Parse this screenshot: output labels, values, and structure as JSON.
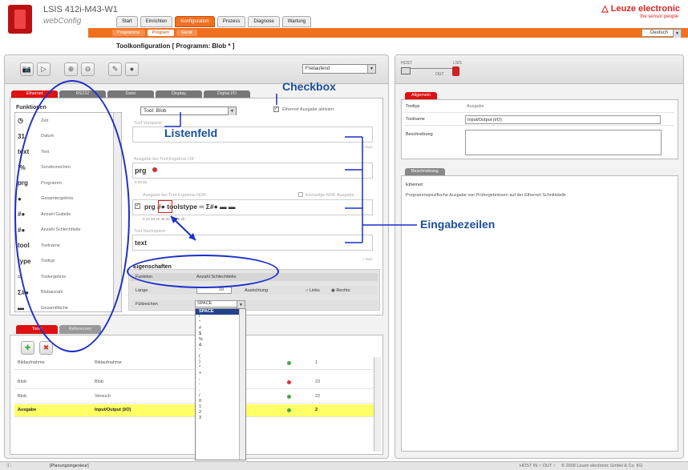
{
  "header": {
    "app_title": "LSIS 412i-M43-W1",
    "app_sub": "webConfig",
    "brand": "△ Leuze electronic",
    "brand_sub": "the sensor people",
    "main_tabs": [
      "Start",
      "Einrichten",
      "Konfiguration",
      "Prozess",
      "Diagnose",
      "Wartung"
    ],
    "sub_tabs": [
      "Programme",
      "Program",
      "Gerät"
    ],
    "language": "Deutsch"
  },
  "page_title": "Toolkonfiguration   [ Programm: Blob * ]",
  "toolbar": {
    "mode": "Freilaufend"
  },
  "left_tabs": [
    "Ethernet",
    "RS232",
    "Datei",
    "Display",
    "Digital I/O"
  ],
  "functions": {
    "title": "Funktionen",
    "items": [
      {
        "icon": "◷",
        "label": "Zeit"
      },
      {
        "icon": "31",
        "label": "Datum"
      },
      {
        "icon": "text",
        "label": "Text"
      },
      {
        "icon": "!%",
        "label": "Sonderzeichen"
      },
      {
        "icon": "prg",
        "label": "Programm"
      },
      {
        "icon": "●",
        "label": "Gesamtergebnis"
      },
      {
        "icon": "#●",
        "label": "Anzahl Gutteile"
      },
      {
        "icon": "#●",
        "label": "Anzahl Schlechtteile"
      },
      {
        "icon": "tool",
        "label": "Toolname"
      },
      {
        "icon": "type",
        "label": "Tooltyp"
      },
      {
        "icon": "═",
        "label": "Toolergebnis"
      },
      {
        "icon": "Σ#●",
        "label": "Blobanzahl"
      },
      {
        "icon": "▬",
        "label": "Gesamtfläche"
      }
    ]
  },
  "tool_select": "Tool: Blob",
  "ethernet_checkbox": "Ethernet Ausgabe aktiviert",
  "fields": {
    "vorspann_label": "Tool Vorspann",
    "ok_label": "Ausgabe bei Tool-Ergebnis OK",
    "ok_value": "prg",
    "ok_ticks": "0      23      33",
    "nok_label": "Ausgabe bei Tool-Ergebnis NOK",
    "nok_once": "Einmalige NOK Ausgabe",
    "nok_value": "prg #● toolstype ═ Σ#● ▬ ▬",
    "nok_ticks": "0    13     28     42    46    56    66    76    86",
    "nach_label": "Tool Nachspann",
    "nach_value": "text",
    "byte": "+ Byte"
  },
  "eigenschaften": {
    "title": "Eigenschaften",
    "funktion_label": "Funktion",
    "funktion_value": "Anzahl Schlechtteile",
    "laenge_label": "Länge",
    "laenge_value": "10",
    "ausrichtung_label": "Ausrichtung",
    "links": "Links",
    "rechts": "Rechts",
    "fuell_label": "Füllzeichen",
    "fuell_value": "SPACE"
  },
  "dropdown_items": [
    "SPACE",
    "!",
    "\"",
    "#",
    "$",
    "%",
    "&",
    "'",
    "(",
    ")",
    "*",
    "+",
    ",",
    "-",
    ".",
    "/",
    "0",
    "1",
    "2",
    "3"
  ],
  "bottom_tabs": [
    "Tools",
    "Referenzen"
  ],
  "tools_table": [
    {
      "a": "Bildaufnahme",
      "b": "Bildaufnahme",
      "c": "1"
    },
    {
      "a": "Blob",
      "b": "Blob",
      "c": "23"
    },
    {
      "a": "Blob",
      "b": "Versuch",
      "c": "22"
    },
    {
      "a": "Ausgabe",
      "b": "Input/Output (I/O)",
      "c": "2"
    }
  ],
  "right": {
    "host": "HOST",
    "lsis": "LSIS",
    "out": "OUT",
    "allgemein_tab": "Allgemein",
    "tooltyp_label": "Tooltyp",
    "tooltyp_value": "Ausgabe",
    "toolname_label": "Toolname",
    "toolname_value": "Input/Output (I/O)",
    "beschreibung_label": "Beschreibung",
    "beschreibung_tab": "Beschreibung",
    "desc_title": "Ethernet:",
    "desc_text": "Programmspezifische Ausgabe von Prüfergebnissen auf der Ethernet Schnittstelle"
  },
  "statusbar": {
    "user": "[Planungsingenieur]",
    "io": "HOST IN ○  OUT ○",
    "copyright": "© 2009 Leuze electronic GmbH & Co. KG"
  },
  "annotations": {
    "checkbox": "Checkbox",
    "listenfeld": "Listenfeld",
    "eingabezeilen": "Eingabezeilen"
  }
}
